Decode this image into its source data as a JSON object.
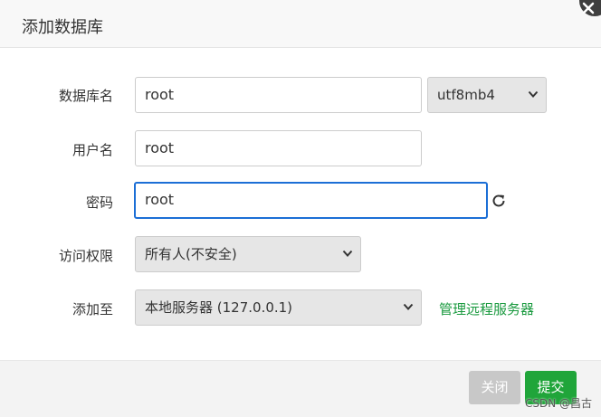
{
  "dialog": {
    "title": "添加数据库"
  },
  "form": {
    "db_name_label": "数据库名",
    "db_name_value": "root",
    "charset_value": "utf8mb4",
    "user_label": "用户名",
    "user_value": "root",
    "password_label": "密码",
    "password_value": "root",
    "access_label": "访问权限",
    "access_value": "所有人(不安全)",
    "add_to_label": "添加至",
    "add_to_value": "本地服务器 (127.0.0.1)",
    "manage_remote_link": "管理远程服务器"
  },
  "footer": {
    "close_label": "关闭",
    "submit_label": "提交"
  },
  "watermark": "CSDN @昌古",
  "colors": {
    "focus_border": "#1c6fd6",
    "link": "#1a9a3f",
    "submit_bg": "#20a53a",
    "close_bg": "#c8c8c8"
  },
  "icons": {
    "close": "close-icon",
    "refresh": "refresh-icon",
    "dropdown": "chevron-down-icon"
  }
}
